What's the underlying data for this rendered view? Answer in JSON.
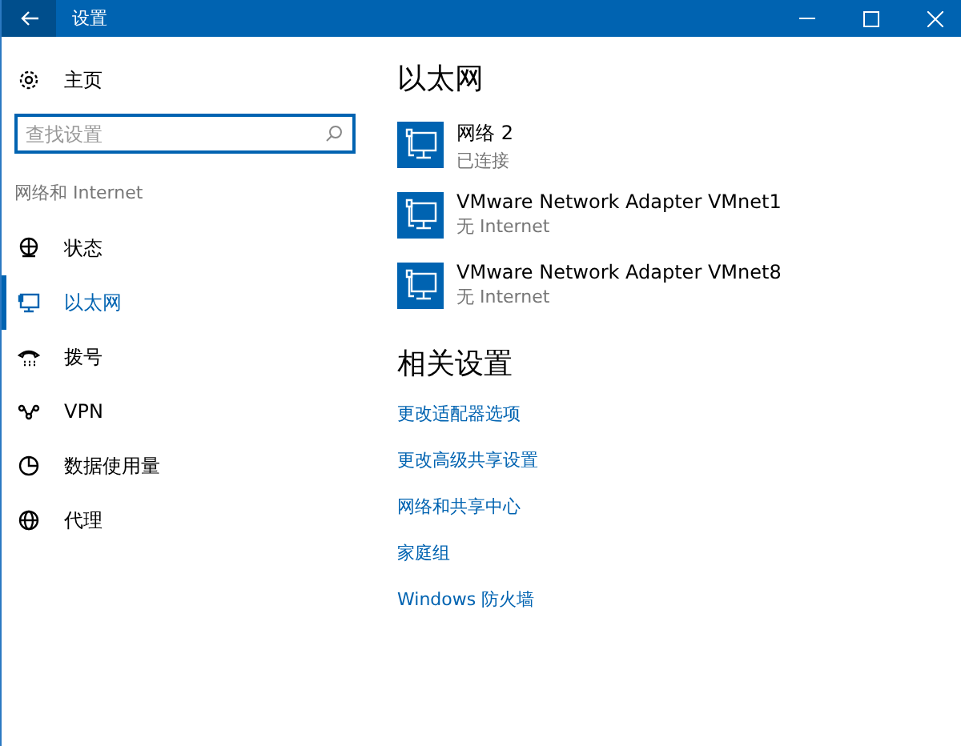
{
  "window": {
    "title": "设置"
  },
  "sidebar": {
    "home": "主页",
    "search": {
      "placeholder": "查找设置"
    },
    "section": "网络和 Internet",
    "items": [
      {
        "label": "状态",
        "kind": "status",
        "selected": false
      },
      {
        "label": "以太网",
        "kind": "ethernet",
        "selected": true
      },
      {
        "label": "拨号",
        "kind": "dialup",
        "selected": false
      },
      {
        "label": "VPN",
        "kind": "vpn",
        "selected": false
      },
      {
        "label": "数据使用量",
        "kind": "data",
        "selected": false
      },
      {
        "label": "代理",
        "kind": "proxy",
        "selected": false
      }
    ]
  },
  "main": {
    "title": "以太网",
    "adapters": [
      {
        "name": "网络  2",
        "status": "已连接"
      },
      {
        "name": "VMware Network Adapter VMnet1",
        "status": "无 Internet"
      },
      {
        "name": "VMware Network Adapter VMnet8",
        "status": "无 Internet"
      }
    ],
    "related_title": "相关设置",
    "links": [
      "更改适配器选项",
      "更改高级共享设置",
      "网络和共享中心",
      "家庭组",
      "Windows 防火墙"
    ]
  }
}
